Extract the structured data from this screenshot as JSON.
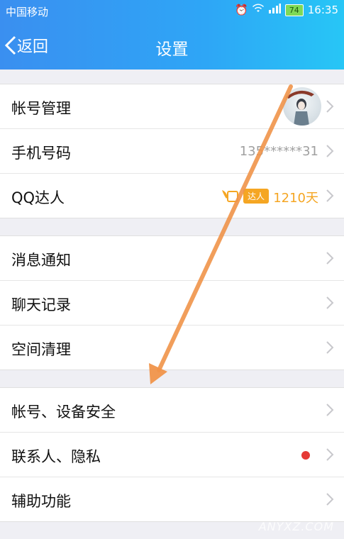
{
  "status": {
    "carrier": "中国移动",
    "battery": "74",
    "time": "16:35"
  },
  "header": {
    "back_label": "返回",
    "title": "设置"
  },
  "groups": [
    {
      "items": [
        {
          "label": "帐号管理"
        },
        {
          "label": "手机号码",
          "value": "135******31"
        },
        {
          "label": "QQ达人",
          "badge": "达人",
          "days": "1210天"
        }
      ]
    },
    {
      "items": [
        {
          "label": "消息通知"
        },
        {
          "label": "聊天记录"
        },
        {
          "label": "空间清理"
        }
      ]
    },
    {
      "items": [
        {
          "label": "帐号、设备安全"
        },
        {
          "label": "联系人、隐私"
        },
        {
          "label": "辅助功能"
        }
      ]
    }
  ],
  "watermark": "ANYXZ.COM",
  "colors": {
    "header": "#2ea6f6",
    "badge": "#f5a623",
    "dot": "#e53935",
    "annotation_arrow": "#f0944a"
  }
}
